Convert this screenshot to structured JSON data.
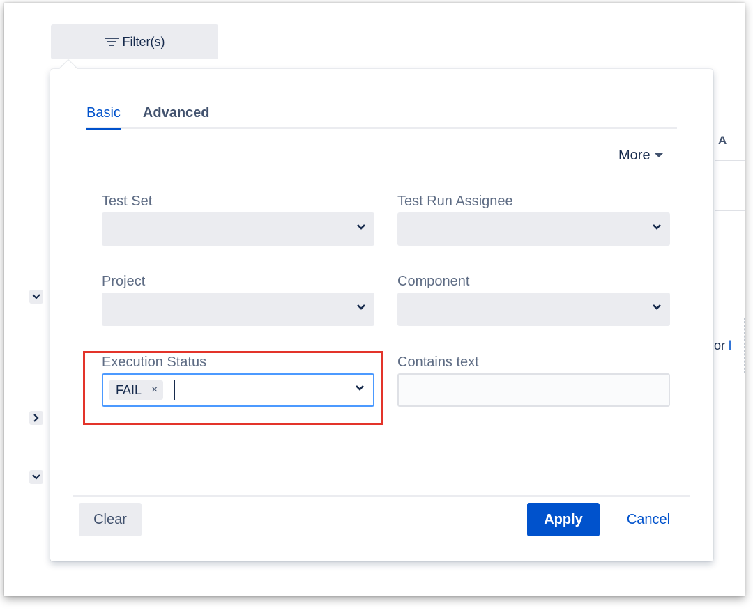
{
  "toolbar": {
    "filter_label": "Filter(s)"
  },
  "background": {
    "column_header_fragment": "A",
    "or_text": "or",
    "link_fragment": "l"
  },
  "tabs": [
    {
      "label": "Basic",
      "active": true
    },
    {
      "label": "Advanced",
      "active": false
    }
  ],
  "more": {
    "label": "More"
  },
  "fields": {
    "test_set": {
      "label": "Test Set",
      "value": ""
    },
    "test_run_assignee": {
      "label": "Test Run Assignee",
      "value": ""
    },
    "project": {
      "label": "Project",
      "value": ""
    },
    "component": {
      "label": "Component",
      "value": ""
    },
    "execution_status": {
      "label": "Execution Status",
      "selected": [
        "FAIL"
      ],
      "remove_glyph": "×"
    },
    "contains_text": {
      "label": "Contains text",
      "value": ""
    }
  },
  "buttons": {
    "clear": "Clear",
    "apply": "Apply",
    "cancel": "Cancel"
  },
  "colors": {
    "primary": "#0052cc",
    "highlight": "#e3342a",
    "focus_border": "#4c9aff"
  }
}
